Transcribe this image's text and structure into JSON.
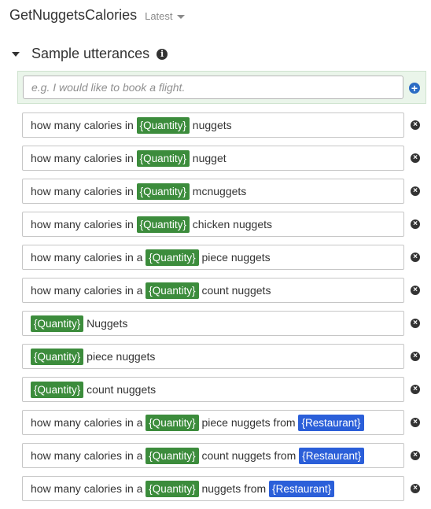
{
  "header": {
    "intent_name": "GetNuggetsCalories",
    "version": "Latest"
  },
  "section": {
    "title": "Sample utterances"
  },
  "input": {
    "placeholder": "e.g. I would like to book a flight."
  },
  "colors": {
    "slot_quantity": "#3c8c3c",
    "slot_restaurant": "#2b5fd9",
    "input_band": "#eaf5ea",
    "add_icon": "#2b6cc4"
  },
  "icons": {
    "collapse": "caret-down-icon",
    "info": "info-icon",
    "add": "plus-circle-icon",
    "remove": "close-circle-icon",
    "version": "chevron-down-icon"
  },
  "utterances": [
    [
      {
        "t": "how many calories in "
      },
      {
        "s": "{Quantity}",
        "c": "green"
      },
      {
        "t": " nuggets"
      }
    ],
    [
      {
        "t": "how many calories in "
      },
      {
        "s": "{Quantity}",
        "c": "green"
      },
      {
        "t": " nugget"
      }
    ],
    [
      {
        "t": "how many calories in "
      },
      {
        "s": "{Quantity}",
        "c": "green"
      },
      {
        "t": " mcnuggets"
      }
    ],
    [
      {
        "t": "how many calories in "
      },
      {
        "s": "{Quantity}",
        "c": "green"
      },
      {
        "t": " chicken nuggets"
      }
    ],
    [
      {
        "t": "how many calories in a "
      },
      {
        "s": "{Quantity}",
        "c": "green"
      },
      {
        "t": " piece nuggets"
      }
    ],
    [
      {
        "t": "how many calories in a "
      },
      {
        "s": "{Quantity}",
        "c": "green"
      },
      {
        "t": " count nuggets"
      }
    ],
    [
      {
        "s": "{Quantity}",
        "c": "green"
      },
      {
        "t": " Nuggets"
      }
    ],
    [
      {
        "s": "{Quantity}",
        "c": "green"
      },
      {
        "t": " piece nuggets"
      }
    ],
    [
      {
        "s": "{Quantity}",
        "c": "green"
      },
      {
        "t": " count nuggets"
      }
    ],
    [
      {
        "t": "how many calories in a "
      },
      {
        "s": "{Quantity}",
        "c": "green"
      },
      {
        "t": " piece nuggets from "
      },
      {
        "s": "{Restaurant}",
        "c": "blue"
      }
    ],
    [
      {
        "t": "how many calories in a "
      },
      {
        "s": "{Quantity}",
        "c": "green"
      },
      {
        "t": " count nuggets from "
      },
      {
        "s": "{Restaurant}",
        "c": "blue"
      }
    ],
    [
      {
        "t": "how many calories in a "
      },
      {
        "s": "{Quantity}",
        "c": "green"
      },
      {
        "t": " nuggets from "
      },
      {
        "s": "{Restaurant}",
        "c": "blue"
      }
    ]
  ]
}
